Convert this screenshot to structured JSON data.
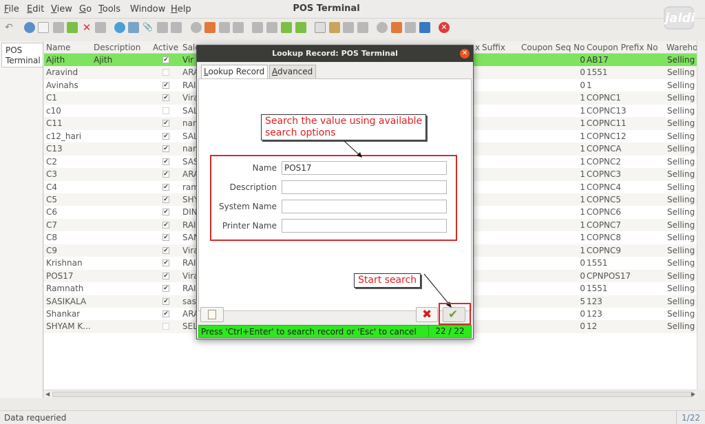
{
  "menu": [
    {
      "label": "File",
      "ul": "F",
      "rest": "ile"
    },
    {
      "label": "Edit",
      "ul": "E",
      "rest": "dit"
    },
    {
      "label": "View",
      "ul": "V",
      "rest": "iew"
    },
    {
      "label": "Go",
      "ul": "G",
      "rest": "o"
    },
    {
      "label": "Tools",
      "ul": "T",
      "rest": "ools"
    },
    {
      "label": "Window",
      "ul": "",
      "rest": "Window"
    },
    {
      "label": "Help",
      "ul": "H",
      "rest": "elp"
    }
  ],
  "app_title": "POS Terminal",
  "logo_text": "jaldi",
  "left_tab": "POS Terminal",
  "grid": {
    "headers": [
      "Name",
      "Description",
      "Active",
      "Sale",
      "x",
      "Suffix",
      "Coupon Seq No",
      "Coupon Prefix No",
      "Wareho"
    ],
    "rows": [
      {
        "name": "Ajith",
        "desc": "Ajith",
        "active": true,
        "sale": "Vir",
        "seq": "0",
        "prefix": "AB17",
        "wh": "Selling",
        "selected": true
      },
      {
        "name": "Aravind",
        "desc": "",
        "active": false,
        "sale": "ARA",
        "seq": "0",
        "prefix": "1551",
        "wh": "Selling"
      },
      {
        "name": "Avinahs",
        "desc": "",
        "active": true,
        "sale": "RAI",
        "seq": "0",
        "prefix": "1",
        "wh": "Selling"
      },
      {
        "name": "C1",
        "desc": "",
        "active": true,
        "sale": "Vira",
        "seq": "1",
        "prefix": "COPNC1",
        "wh": "Selling"
      },
      {
        "name": "c10",
        "desc": "",
        "active": false,
        "sale": "SAL",
        "seq": "1",
        "prefix": "COPNC13",
        "wh": "Selling"
      },
      {
        "name": "C11",
        "desc": "",
        "active": true,
        "sale": "nar",
        "seq": "1",
        "prefix": "COPNC11",
        "wh": "Selling"
      },
      {
        "name": "c12_hari",
        "desc": "",
        "active": true,
        "sale": "SAL",
        "seq": "1",
        "prefix": "COPNC12",
        "wh": "Selling"
      },
      {
        "name": "C13",
        "desc": "",
        "active": true,
        "sale": "nar",
        "seq": "1",
        "prefix": "COPNCA",
        "wh": "Selling"
      },
      {
        "name": "C2",
        "desc": "",
        "active": true,
        "sale": "SAS",
        "seq": "1",
        "prefix": "COPNC2",
        "wh": "Selling"
      },
      {
        "name": "C3",
        "desc": "",
        "active": true,
        "sale": "ARA",
        "seq": "1",
        "prefix": "COPNC3",
        "wh": "Selling"
      },
      {
        "name": "C4",
        "desc": "",
        "active": true,
        "sale": "ram",
        "seq": "1",
        "prefix": "COPNC4",
        "wh": "Selling"
      },
      {
        "name": "C5",
        "desc": "",
        "active": true,
        "sale": "SHY",
        "seq": "1",
        "prefix": "COPNC5",
        "wh": "Selling"
      },
      {
        "name": "C6",
        "desc": "",
        "active": true,
        "sale": "DIN",
        "seq": "1",
        "prefix": "COPNC6",
        "wh": "Selling"
      },
      {
        "name": "C7",
        "desc": "",
        "active": true,
        "sale": "RAI",
        "seq": "1",
        "prefix": "COPNC7",
        "wh": "Selling"
      },
      {
        "name": "C8",
        "desc": "",
        "active": true,
        "sale": "SAN",
        "seq": "1",
        "prefix": "COPNC8",
        "wh": "Selling"
      },
      {
        "name": "C9",
        "desc": "",
        "active": true,
        "sale": "Vira",
        "seq": "1",
        "prefix": "COPNC9",
        "wh": "Selling"
      },
      {
        "name": "Krishnan",
        "desc": "",
        "active": true,
        "sale": "RAI",
        "seq": "0",
        "prefix": "1551",
        "wh": "Selling"
      },
      {
        "name": "POS17",
        "desc": "",
        "active": true,
        "sale": "Vira",
        "seq": "0",
        "prefix": "CPNPOS17",
        "wh": "Selling"
      },
      {
        "name": "Ramnath",
        "desc": "",
        "active": true,
        "sale": "RAI",
        "seq": "0",
        "prefix": "1551",
        "wh": "Selling"
      },
      {
        "name": "SASIKALA",
        "desc": "",
        "active": true,
        "sale": "sas",
        "seq": "5",
        "prefix": "123",
        "wh": "Selling"
      },
      {
        "name": "Shankar",
        "desc": "",
        "active": true,
        "sale": "ARA",
        "seq": "0",
        "prefix": "123",
        "wh": "Selling"
      },
      {
        "name": "SHYAM K...",
        "desc": "",
        "active": false,
        "sale": "SEL",
        "seq": "0",
        "prefix": "12",
        "wh": "Selling"
      }
    ]
  },
  "status": {
    "message": "Data requeried",
    "count": "1/22"
  },
  "dialog": {
    "title": "Lookup Record: POS Terminal",
    "tabs": [
      {
        "label": "Lookup Record",
        "ul": "L",
        "rest": "ookup Record"
      },
      {
        "label": "Advanced",
        "ul": "A",
        "rest": "dvanced"
      }
    ],
    "fields": [
      {
        "label": "Name",
        "value": "POS17"
      },
      {
        "label": "Description",
        "value": ""
      },
      {
        "label": "System Name",
        "value": ""
      },
      {
        "label": "Printer Name",
        "value": ""
      }
    ],
    "callout_search": [
      "Search the value using available",
      "search options"
    ],
    "callout_start": "Start search",
    "footer_msg": "Press 'Ctrl+Enter' to search record or 'Esc' to cancel",
    "footer_count": "22 / 22"
  },
  "colors": {
    "selected_row": "#7fe35f",
    "footer": "#2ee81e",
    "callout_text": "#e01f1f"
  }
}
